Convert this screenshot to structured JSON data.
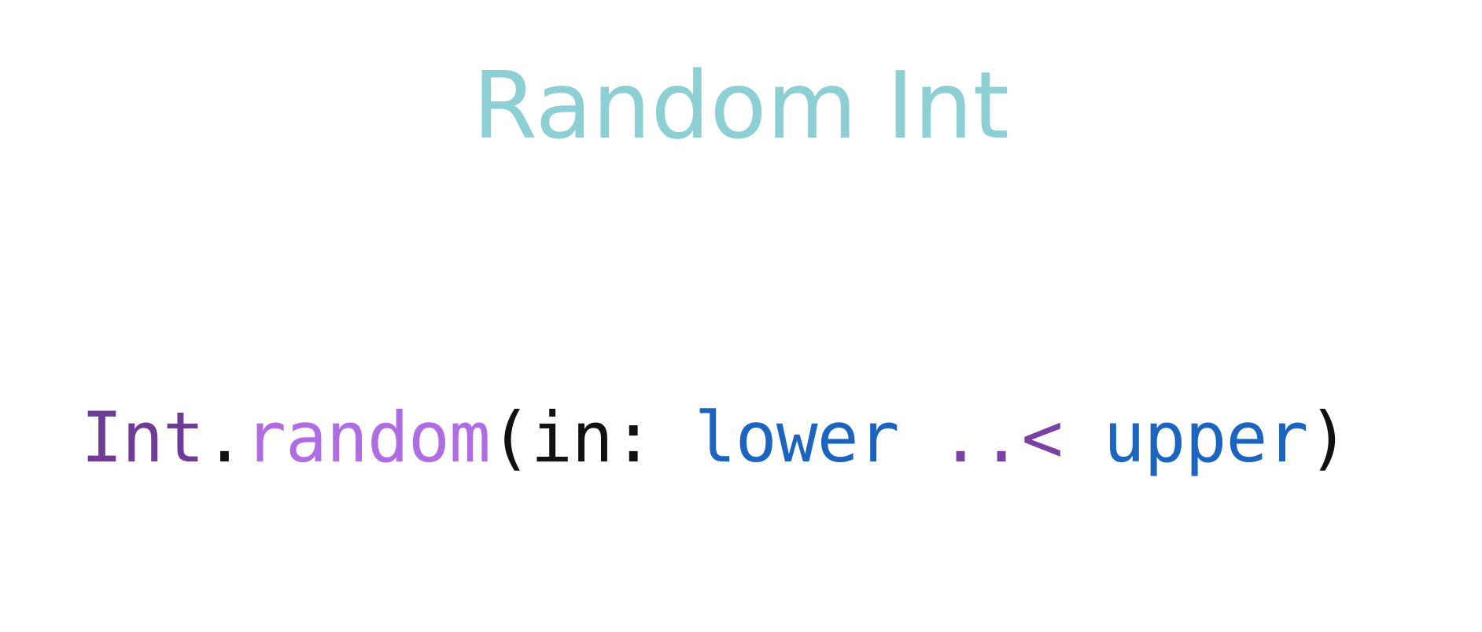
{
  "slide": {
    "title": "Random Int",
    "code_tokens": [
      {
        "text": "Int",
        "role": "type"
      },
      {
        "text": ".",
        "role": "punctuation"
      },
      {
        "text": "random",
        "role": "method"
      },
      {
        "text": "(",
        "role": "punctuation"
      },
      {
        "text": "in",
        "role": "label"
      },
      {
        "text": ": ",
        "role": "punctuation"
      },
      {
        "text": "lower",
        "role": "variable"
      },
      {
        "text": " ",
        "role": "space"
      },
      {
        "text": "..<",
        "role": "operator"
      },
      {
        "text": " ",
        "role": "space"
      },
      {
        "text": "upper",
        "role": "variable"
      },
      {
        "text": ")",
        "role": "punctuation"
      }
    ]
  },
  "colors": {
    "background": "#ffffff",
    "title": "#8ccfd4",
    "type": "#6e3b96",
    "method": "#b06de3",
    "variable": "#1b64c0",
    "operator": "#7a40a3",
    "plain": "#111111"
  }
}
